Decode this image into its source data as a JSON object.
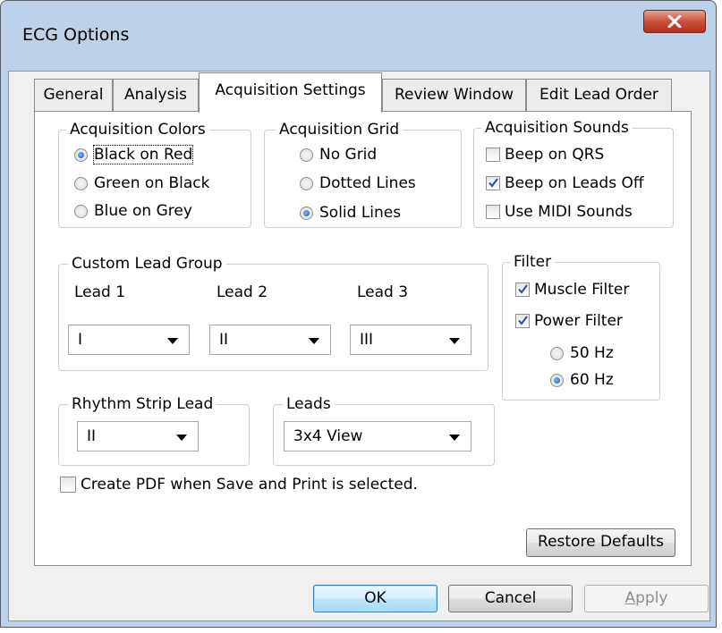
{
  "window": {
    "title": "ECG Options"
  },
  "tabs": [
    {
      "label": "General"
    },
    {
      "label": "Analysis"
    },
    {
      "label": "Acquisition Settings"
    },
    {
      "label": "Review Window"
    },
    {
      "label": "Edit Lead Order"
    }
  ],
  "acquisition_colors": {
    "title": "Acquisition Colors",
    "options": [
      "Black on Red",
      "Green on Black",
      "Blue on Grey"
    ],
    "selected": "Black on Red"
  },
  "acquisition_grid": {
    "title": "Acquisition Grid",
    "options": [
      "No Grid",
      "Dotted Lines",
      "Solid Lines"
    ],
    "selected": "Solid Lines"
  },
  "acquisition_sounds": {
    "title": "Acquisition Sounds",
    "options": [
      {
        "label": "Beep on QRS",
        "checked": false
      },
      {
        "label": "Beep on Leads Off",
        "checked": true
      },
      {
        "label": "Use MIDI Sounds",
        "checked": false
      }
    ]
  },
  "custom_lead_group": {
    "title": "Custom Lead Group",
    "leads": [
      {
        "label": "Lead 1",
        "value": "I"
      },
      {
        "label": "Lead 2",
        "value": "II"
      },
      {
        "label": "Lead 3",
        "value": "III"
      }
    ]
  },
  "filter": {
    "title": "Filter",
    "muscle_filter": {
      "label": "Muscle Filter",
      "checked": true
    },
    "power_filter": {
      "label": "Power Filter",
      "checked": true
    },
    "frequency_options": [
      "50 Hz",
      "60 Hz"
    ],
    "selected_frequency": "60 Hz"
  },
  "rhythm_strip_lead": {
    "title": "Rhythm Strip Lead",
    "value": "II"
  },
  "leads": {
    "title": "Leads",
    "value": "3x4 View"
  },
  "create_pdf": {
    "label": "Create PDF when Save and Print is selected.",
    "checked": false
  },
  "buttons": {
    "restore_defaults": "Restore Defaults",
    "ok": "OK",
    "cancel": "Cancel",
    "apply_prefix": "A",
    "apply_rest": "pply"
  },
  "colors": {
    "title_bar": "#bcd1ea",
    "close_button": "#c9513c",
    "radio_selected": "#1b54b8",
    "check_mark": "#2a4f9e"
  }
}
